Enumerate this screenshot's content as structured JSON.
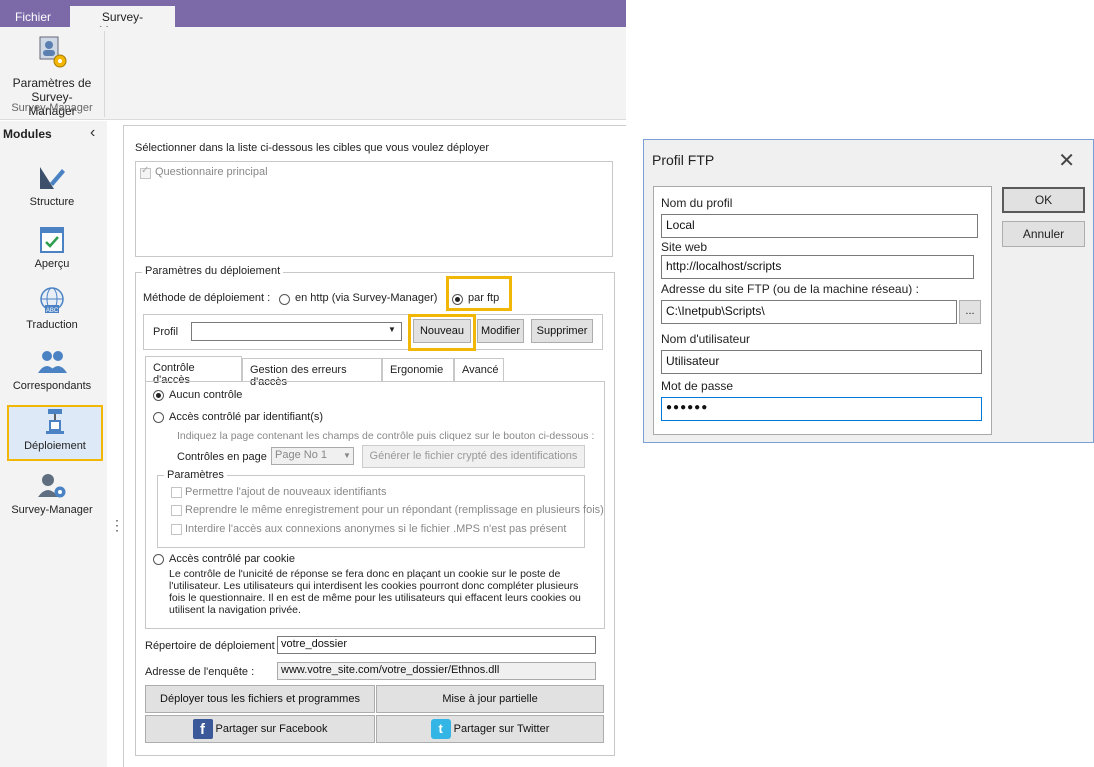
{
  "ribbon": {
    "tabs": [
      "Fichier",
      "Survey-Manager"
    ],
    "button_label_1": "Paramètres de",
    "button_label_2": "Survey-Manager",
    "group_label": "Survey-Manager"
  },
  "sidebar": {
    "title": "Modules",
    "collapse_icon": "chevron-left-icon",
    "items": [
      {
        "label": "Structure",
        "icon": "pen-ruler-icon"
      },
      {
        "label": "Aperçu",
        "icon": "checklist-icon"
      },
      {
        "label": "Traduction",
        "icon": "globe-abc-icon"
      },
      {
        "label": "Correspondants",
        "icon": "people-icon"
      },
      {
        "label": "Déploiement",
        "icon": "deploy-icon"
      },
      {
        "label": "Survey-Manager",
        "icon": "user-gear-icon"
      }
    ],
    "active_index": 4
  },
  "main": {
    "intro": "Sélectionner dans la liste ci-dessous les cibles que vous voulez déployer",
    "target_item": "Questionnaire principal",
    "deploy_params_title": "Paramètres du déploiement",
    "method_label": "Méthode de déploiement :",
    "method_http": "en http (via Survey-Manager)",
    "method_ftp": "par ftp",
    "profile_label": "Profil",
    "profile_value": "",
    "btn_new": "Nouveau",
    "btn_edit": "Modifier",
    "btn_delete": "Supprimer",
    "tabs": [
      "Contrôle d'accès",
      "Gestion des erreurs d'accès",
      "Ergonomie",
      "Avancé"
    ],
    "access": {
      "none": "Aucun contrôle",
      "by_id": "Accès contrôlé par identifiant(s)",
      "hint": "Indiquez la page contenant les champs de contrôle puis cliquez sur le bouton ci-dessous :",
      "controls_label": "Contrôles en page :",
      "controls_value": "Page No 1",
      "gen_button": "Générer le fichier crypté des identifications",
      "params_title": "Paramètres",
      "opt1": "Permettre l'ajout de nouveaux identifiants",
      "opt2": "Reprendre le même enregistrement pour un répondant (remplissage en plusieurs fois)",
      "opt3": "Interdire l'accès aux connexions anonymes si le fichier .MPS n'est pas présent",
      "by_cookie": "Accès contrôlé par cookie",
      "cookie_line1": "Le contrôle de l'unicité de réponse se fera donc en plaçant un cookie sur le poste de",
      "cookie_line2": "l'utilisateur. Les utilisateurs qui interdisent les cookies pourront donc compléter plusieurs",
      "cookie_line3": "fois le questionnaire. Il en est de même pour les utilisateurs qui effacent leurs cookies ou",
      "cookie_line4": "utilisent la navigation privée."
    },
    "dir_label": "Répertoire de déploiement :",
    "dir_value": "votre_dossier",
    "url_label": "Adresse de l'enquête :",
    "url_value": "www.votre_site.com/votre_dossier/Ethnos.dll",
    "btn_deploy_all": "Déployer tous les fichiers et programmes",
    "btn_partial": "Mise à jour partielle",
    "btn_facebook": "Partager sur Facebook",
    "btn_twitter": "Partager sur Twitter"
  },
  "dialog": {
    "title": "Profil FTP",
    "name_label": "Nom du profil",
    "name_value": "Local",
    "site_label": "Site web",
    "site_value": "http://localhost/scripts",
    "ftp_label": "Adresse du site FTP (ou de la machine réseau) :",
    "ftp_value": "C:\\Inetpub\\Scripts\\",
    "browse": "...",
    "user_label": "Nom d'utilisateur",
    "user_value": "Utilisateur",
    "pass_label": "Mot de passe",
    "pass_value": "●●●●●●",
    "ok": "OK",
    "cancel": "Annuler"
  },
  "colors": {
    "ribbon": "#7b69a8",
    "highlight": "#f2b705",
    "facebook": "#3b5998",
    "twitter": "#33b5e5"
  }
}
